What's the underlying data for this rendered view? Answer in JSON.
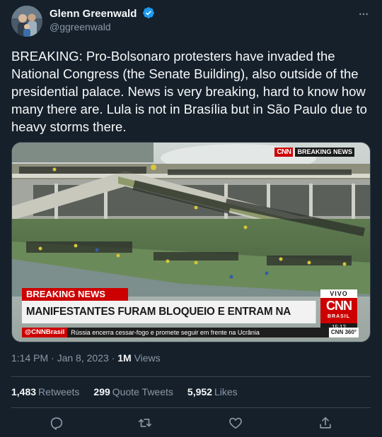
{
  "author": {
    "name": "Glenn Greenwald",
    "handle": "@ggreenwald",
    "verified": true,
    "avatar_icon": "profile-photo"
  },
  "tweet": {
    "text": "BREAKING: Pro-Bolsonaro protesters have invaded the National Congress (the Senate Building), also outside of the presidential palace. News is very breaking, hard to know how many there are. Lula is not in Brasília but in São Paulo due to heavy storms there."
  },
  "media": {
    "corner_logo": "CNN",
    "corner_label": "BREAKING NEWS",
    "breaking_label": "BREAKING NEWS",
    "headline": "MANIFESTANTES FURAM BLOQUEIO E ENTRAM NA ESPLANADA",
    "live_label": "VIVO",
    "channel_logo": "CNN",
    "channel_sub": "BRASIL",
    "clock": "15:12",
    "ticker_brand": "@CNNBrasil",
    "ticker_text": "Rússia encerra cessar-fogo e promete seguir em frente na Ucrânia",
    "ticker_tag": "CNN 360°"
  },
  "meta": {
    "time": "1:14 PM",
    "separator": "·",
    "date": "Jan 8, 2023",
    "views_count": "1M",
    "views_label": "Views"
  },
  "stats": [
    {
      "count": "1,483",
      "label": "Retweets"
    },
    {
      "count": "299",
      "label": "Quote Tweets"
    },
    {
      "count": "5,952",
      "label": "Likes"
    }
  ],
  "actions": [
    "reply-icon",
    "retweet-icon",
    "like-icon",
    "share-icon"
  ],
  "colors": {
    "background": "#15202b",
    "text": "#f7f9f9",
    "muted": "#8b98a5",
    "verified": "#1d9bf0",
    "cnn_red": "#cc0000"
  }
}
